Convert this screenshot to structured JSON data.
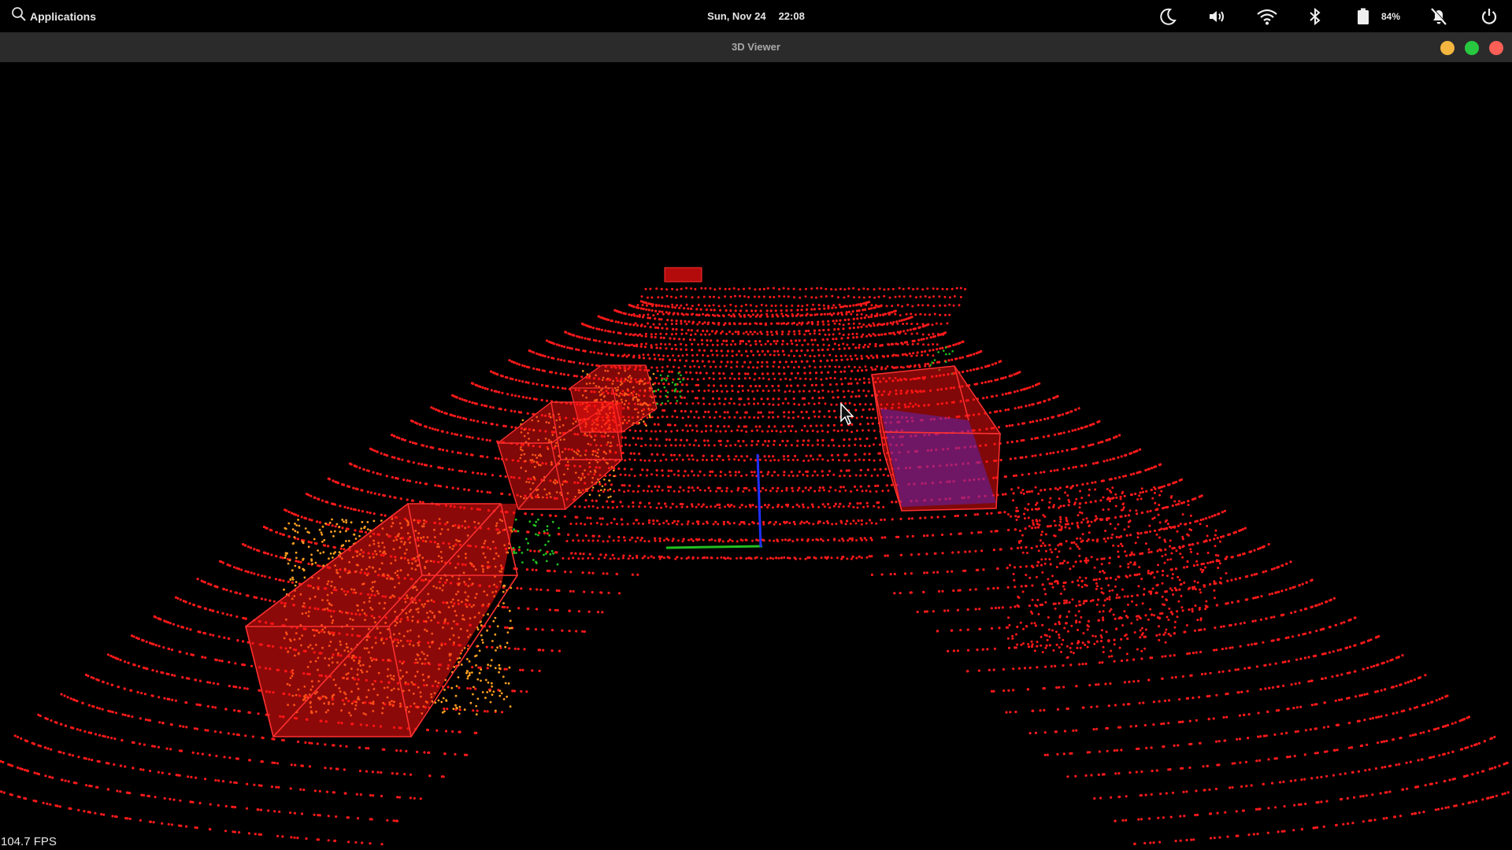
{
  "panel": {
    "applications_label": "Applications",
    "date": "Sun, Nov 24",
    "time": "22:08",
    "battery_percent": "84%",
    "icons": [
      "search-icon",
      "night-mode-icon",
      "volume-icon",
      "wifi-icon",
      "bluetooth-icon",
      "battery-icon",
      "notifications-off-icon",
      "power-icon"
    ]
  },
  "window": {
    "title": "3D Viewer",
    "buttons": [
      "minimize",
      "maximize",
      "close"
    ],
    "colors": {
      "minimize": "#f4b63f",
      "maximize": "#28c840",
      "close": "#ff5f57"
    }
  },
  "viewer": {
    "fps_label": "104.7 FPS",
    "point_color": "#ff1a1a",
    "highlight_color": "#ffa020",
    "box_color": "#ff2020",
    "axis_colors": {
      "x": "#20c020",
      "z": "#2030ff"
    }
  }
}
